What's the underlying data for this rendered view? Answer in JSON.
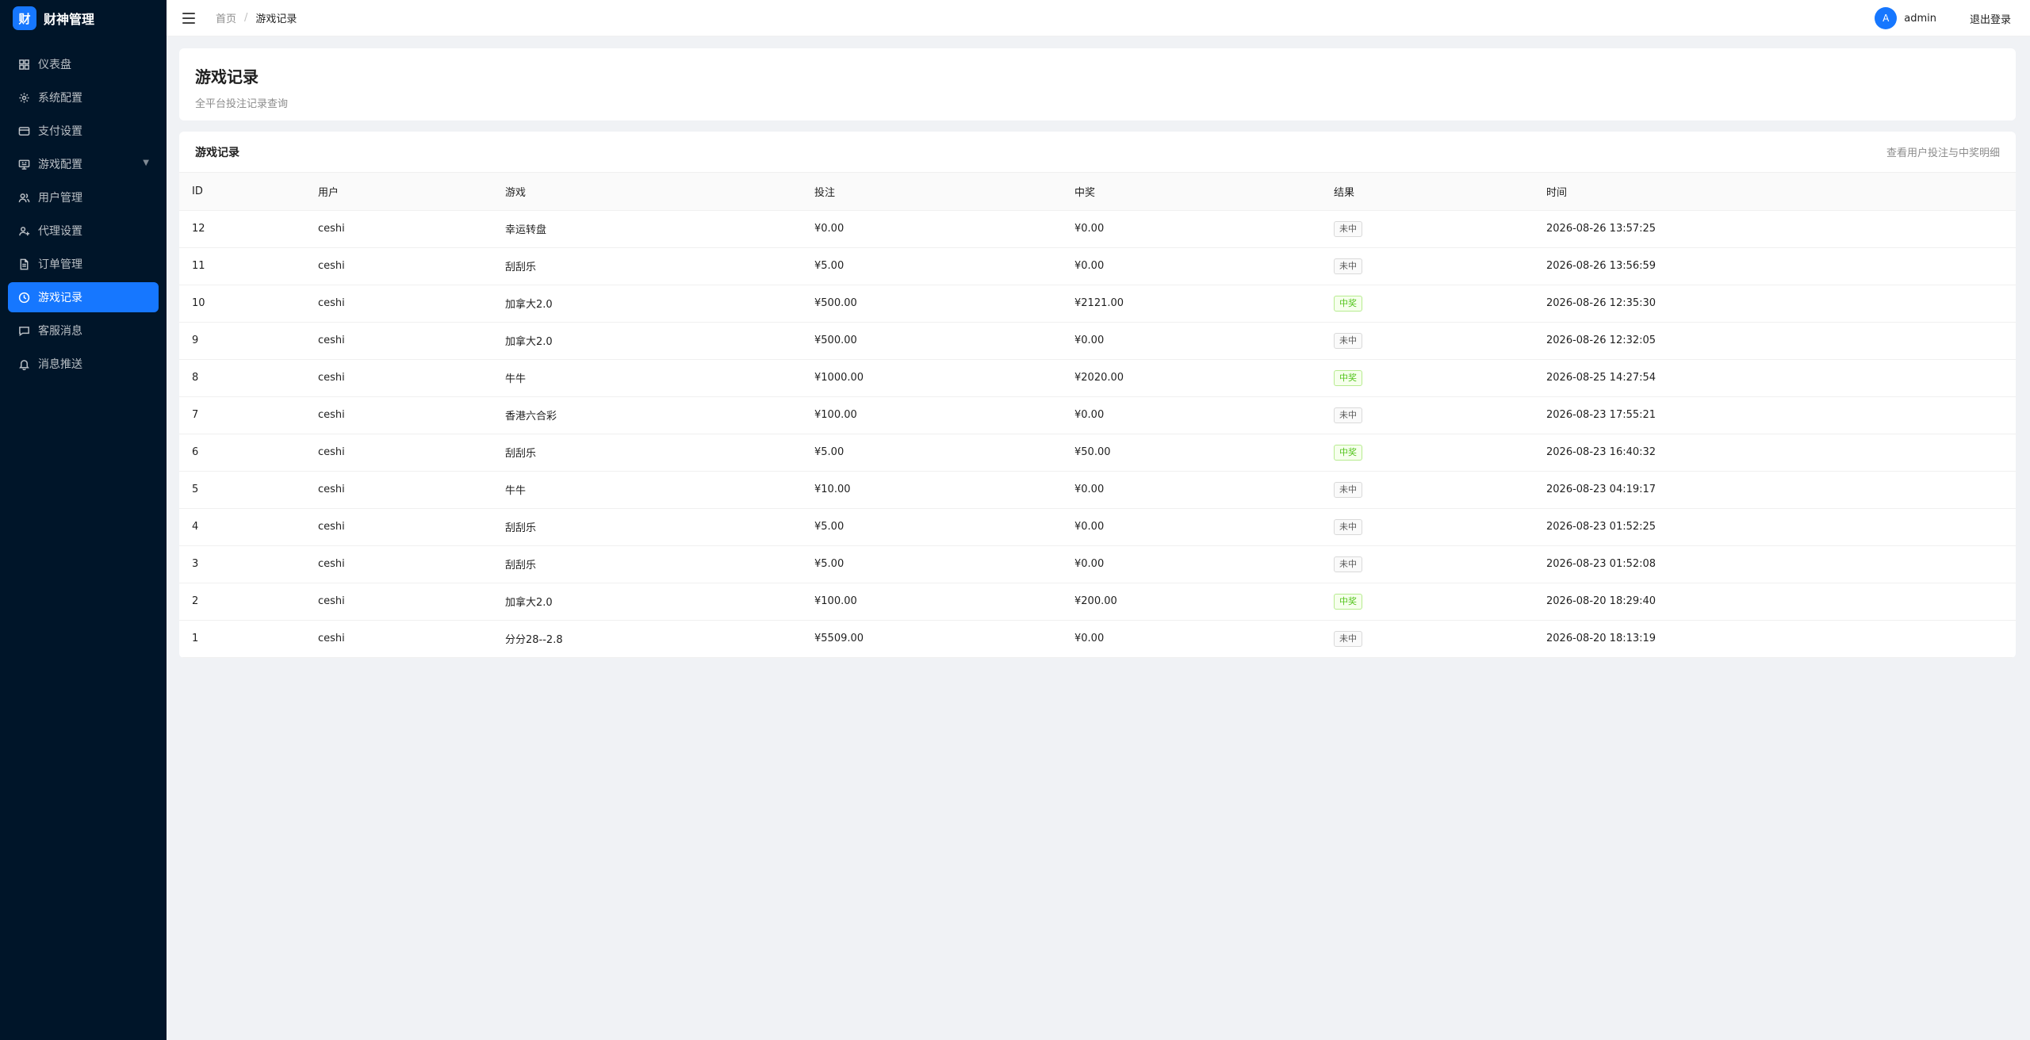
{
  "sidebar": {
    "brand_logo": "财",
    "brand_name": "财神管理",
    "items": [
      {
        "label": "仪表盘",
        "icon": "dashboard-icon"
      },
      {
        "label": "系统配置",
        "icon": "gear-icon"
      },
      {
        "label": "支付设置",
        "icon": "credit-card-icon"
      },
      {
        "label": "游戏配置",
        "icon": "monitor-icon",
        "has_submenu": true
      },
      {
        "label": "用户管理",
        "icon": "users-icon"
      },
      {
        "label": "代理设置",
        "icon": "user-plus-icon"
      },
      {
        "label": "订单管理",
        "icon": "document-icon"
      },
      {
        "label": "游戏记录",
        "icon": "clock-icon",
        "active": true
      },
      {
        "label": "客服消息",
        "icon": "chat-icon"
      },
      {
        "label": "消息推送",
        "icon": "bell-icon"
      }
    ],
    "submenu_arrow": "▼"
  },
  "header": {
    "breadcrumb_home": "首页",
    "breadcrumb_sep": "/",
    "breadcrumb_current": "游戏记录",
    "avatar_letter": "A",
    "username": "admin",
    "logout": "退出登录"
  },
  "page": {
    "title": "游戏记录",
    "subtitle": "全平台投注记录查询"
  },
  "card": {
    "title": "游戏记录",
    "extra": "查看用户投注与中奖明细"
  },
  "table": {
    "columns": [
      "ID",
      "用户",
      "游戏",
      "投注",
      "中奖",
      "结果",
      "时间"
    ],
    "rows": [
      {
        "id": "12",
        "user": "ceshi",
        "game": "幸运转盘",
        "bet": "¥0.00",
        "win": "¥0.00",
        "result": "未中",
        "won": false,
        "time": "2026-08-26 13:57:25"
      },
      {
        "id": "11",
        "user": "ceshi",
        "game": "刮刮乐",
        "bet": "¥5.00",
        "win": "¥0.00",
        "result": "未中",
        "won": false,
        "time": "2026-08-26 13:56:59"
      },
      {
        "id": "10",
        "user": "ceshi",
        "game": "加拿大2.0",
        "bet": "¥500.00",
        "win": "¥2121.00",
        "result": "中奖",
        "won": true,
        "time": "2026-08-26 12:35:30"
      },
      {
        "id": "9",
        "user": "ceshi",
        "game": "加拿大2.0",
        "bet": "¥500.00",
        "win": "¥0.00",
        "result": "未中",
        "won": false,
        "time": "2026-08-26 12:32:05"
      },
      {
        "id": "8",
        "user": "ceshi",
        "game": "牛牛",
        "bet": "¥1000.00",
        "win": "¥2020.00",
        "result": "中奖",
        "won": true,
        "time": "2026-08-25 14:27:54"
      },
      {
        "id": "7",
        "user": "ceshi",
        "game": "香港六合彩",
        "bet": "¥100.00",
        "win": "¥0.00",
        "result": "未中",
        "won": false,
        "time": "2026-08-23 17:55:21"
      },
      {
        "id": "6",
        "user": "ceshi",
        "game": "刮刮乐",
        "bet": "¥5.00",
        "win": "¥50.00",
        "result": "中奖",
        "won": true,
        "time": "2026-08-23 16:40:32"
      },
      {
        "id": "5",
        "user": "ceshi",
        "game": "牛牛",
        "bet": "¥10.00",
        "win": "¥0.00",
        "result": "未中",
        "won": false,
        "time": "2026-08-23 04:19:17"
      },
      {
        "id": "4",
        "user": "ceshi",
        "game": "刮刮乐",
        "bet": "¥5.00",
        "win": "¥0.00",
        "result": "未中",
        "won": false,
        "time": "2026-08-23 01:52:25"
      },
      {
        "id": "3",
        "user": "ceshi",
        "game": "刮刮乐",
        "bet": "¥5.00",
        "win": "¥0.00",
        "result": "未中",
        "won": false,
        "time": "2026-08-23 01:52:08"
      },
      {
        "id": "2",
        "user": "ceshi",
        "game": "加拿大2.0",
        "bet": "¥100.00",
        "win": "¥200.00",
        "result": "中奖",
        "won": true,
        "time": "2026-08-20 18:29:40"
      },
      {
        "id": "1",
        "user": "ceshi",
        "game": "分分28--2.8",
        "bet": "¥5509.00",
        "win": "¥0.00",
        "result": "未中",
        "won": false,
        "time": "2026-08-20 18:13:19"
      }
    ]
  },
  "colors": {
    "sidebar_bg": "#001529",
    "accent": "#1677ff",
    "win_tag": "#52c41a",
    "page_bg": "#f0f2f5"
  }
}
